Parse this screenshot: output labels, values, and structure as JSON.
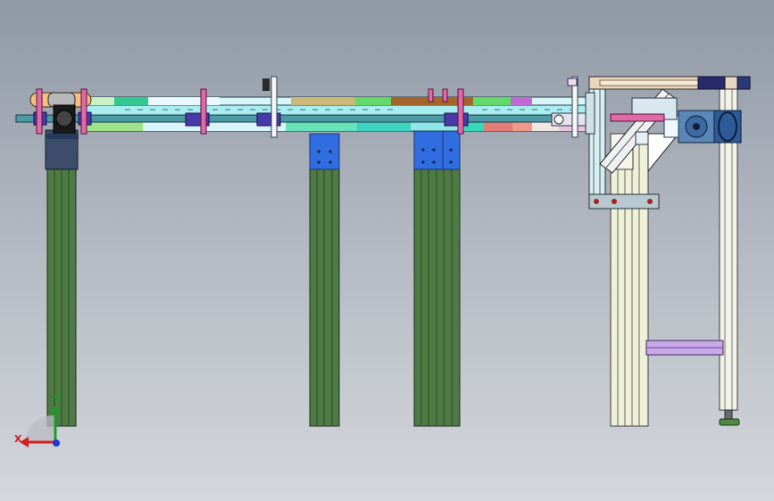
{
  "viewport": {
    "background_top": "#8f98a5",
    "background_bottom": "#d4d7dc"
  },
  "model": {
    "description_colors": {
      "frame_green": "#4e7a44",
      "frame_green_dark": "#2a4a26",
      "bracket_blue": "#2f6de0",
      "chain_cyan": "#6fe6d8",
      "clamp_purple": "#4a3aa8",
      "bolt_pink": "#e06aa6",
      "motor_blue": "#5a86b8",
      "frame_cream": "#eef0d8",
      "brace_lavender": "#c9a8e8"
    }
  },
  "triad": {
    "x_label": "X",
    "y_label": "Y",
    "x_color": "#d11f1f",
    "y_color": "#1f9a2a",
    "z_color": "#1a3ad8"
  }
}
